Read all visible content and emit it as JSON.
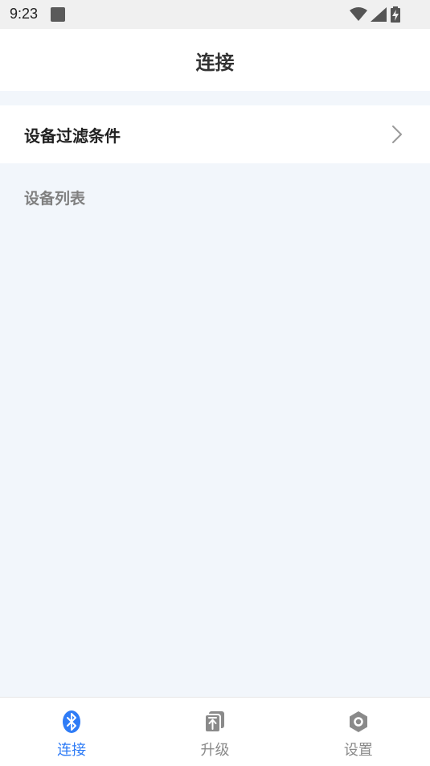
{
  "status_bar": {
    "time": "9:23"
  },
  "header": {
    "title": "连接"
  },
  "filter": {
    "label": "设备过滤条件"
  },
  "device_section": {
    "title": "设备列表",
    "items": []
  },
  "bottom_nav": {
    "items": [
      {
        "label": "连接",
        "icon": "bluetooth-icon",
        "active": true
      },
      {
        "label": "升级",
        "icon": "upgrade-icon",
        "active": false
      },
      {
        "label": "设置",
        "icon": "settings-icon",
        "active": false
      }
    ],
    "active_color": "#2f7cf6",
    "inactive_color": "#8a8a8a"
  }
}
